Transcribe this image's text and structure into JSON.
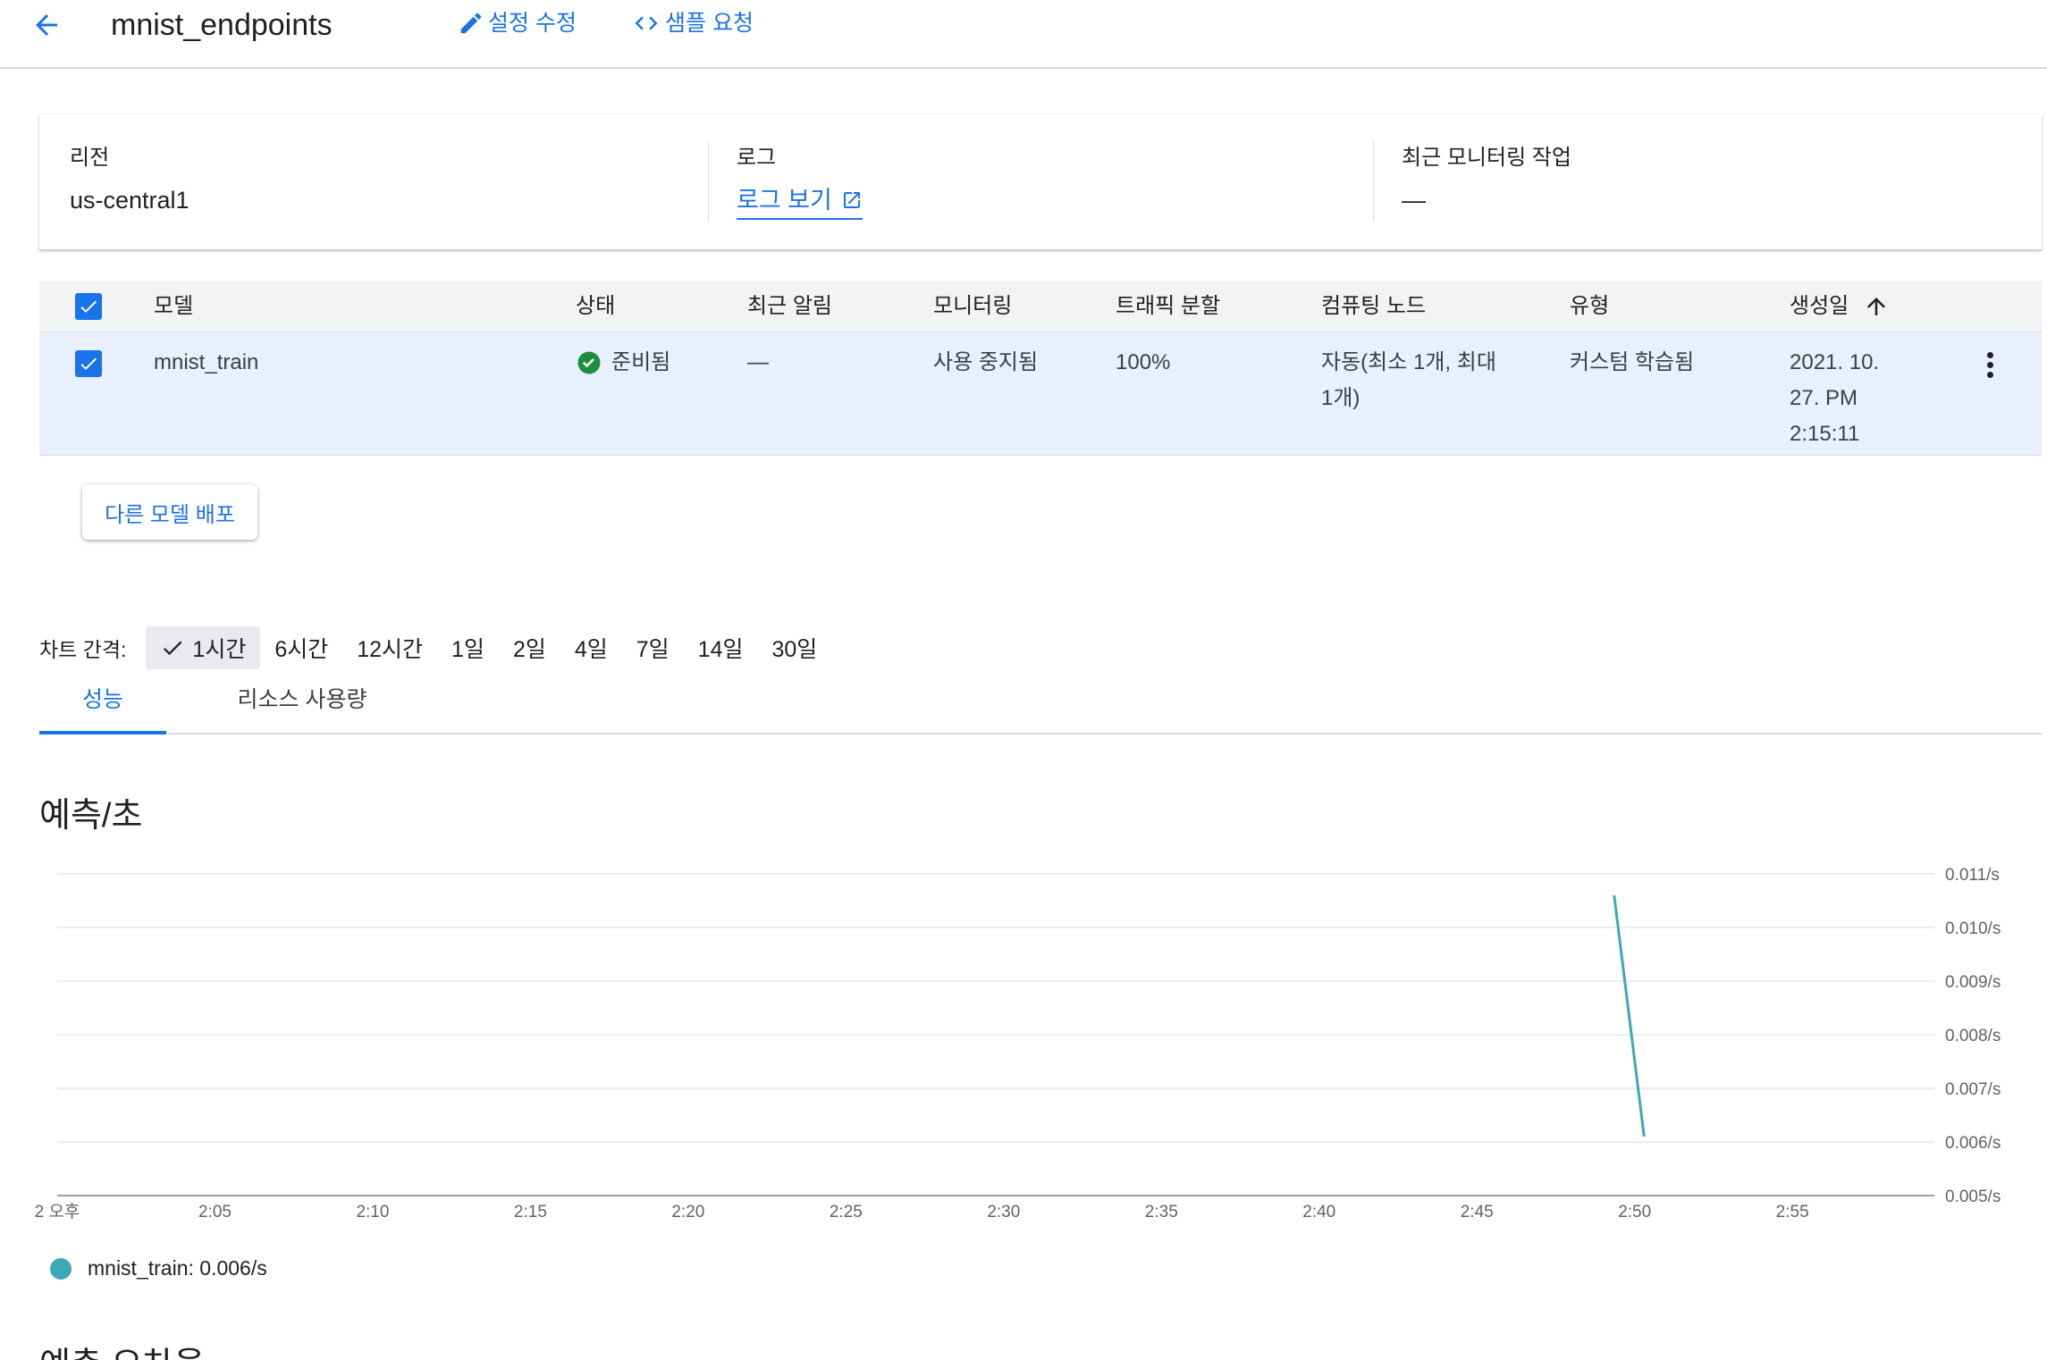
{
  "header": {
    "title": "mnist_endpoints",
    "edit_label": "설정 수정",
    "sample_label": "샘플 요청"
  },
  "info": {
    "region_label": "리전",
    "region_value": "us-central1",
    "log_label": "로그",
    "log_link": "로그 보기",
    "monitoring_label": "최근 모니터링 작업",
    "monitoring_value": "—"
  },
  "table": {
    "headers": {
      "model": "모델",
      "status": "상태",
      "alert": "최근 알림",
      "monitoring": "모니터링",
      "traffic": "트래픽 분할",
      "compute": "컴퓨팅 노드",
      "type": "유형",
      "created": "생성일"
    },
    "rows": [
      {
        "model": "mnist_train",
        "status": "준비됨",
        "alert": "—",
        "monitoring": "사용 중지됨",
        "traffic": "100%",
        "compute_line1": "자동(최소 1개, 최대",
        "compute_line2": "1개)",
        "type": "커스텀 학습됨",
        "created_line1": "2021. 10.",
        "created_line2": "27. PM",
        "created_line3": "2:15:11"
      }
    ]
  },
  "deploy_button": "다른 모델 배포",
  "interval": {
    "label": "차트 간격:",
    "options": [
      "1시간",
      "6시간",
      "12시간",
      "1일",
      "2일",
      "4일",
      "7일",
      "14일",
      "30일"
    ],
    "selected": "1시간"
  },
  "tabs": [
    "성능",
    "리소스 사용량"
  ],
  "section_title": "예측/초",
  "section_title_next": "예측 오차율",
  "colors": {
    "accent": "#1a73e8",
    "series": "#3ca9b8",
    "status_ok": "#1e8e3e"
  },
  "chart_data": {
    "type": "line",
    "title": "예측/초",
    "x_ticks": [
      "2 오후",
      "2:05",
      "2:10",
      "2:15",
      "2:20",
      "2:25",
      "2:30",
      "2:35",
      "2:40",
      "2:45",
      "2:50",
      "2:55"
    ],
    "x_range_minutes": [
      0,
      59.5
    ],
    "y_ticks": [
      "0.011/s",
      "0.010/s",
      "0.009/s",
      "0.008/s",
      "0.007/s",
      "0.006/s",
      "0.005/s"
    ],
    "ylim": [
      0.005,
      0.011
    ],
    "grid": true,
    "legend_position": "bottom-left",
    "series": [
      {
        "name": "mnist_train",
        "legend_value": "0.006/s",
        "points": [
          {
            "x": 49.35,
            "y": 0.0106
          },
          {
            "x": 50.3,
            "y": 0.0061
          }
        ]
      }
    ]
  }
}
